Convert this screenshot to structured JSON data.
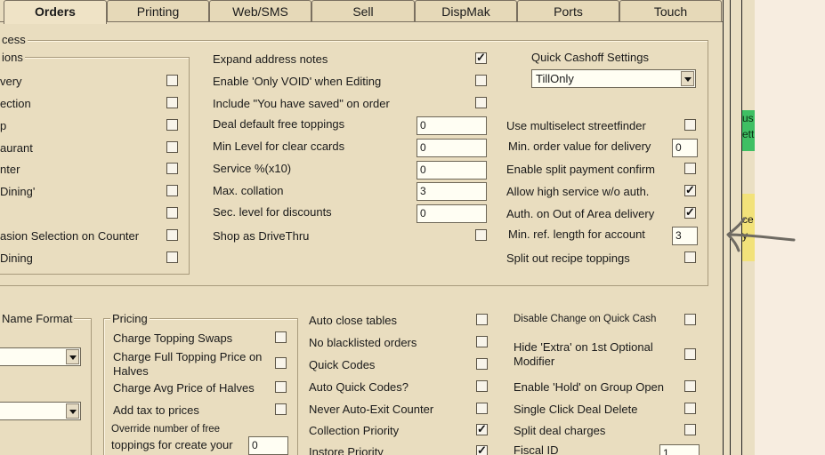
{
  "tabs": [
    "Orders",
    "Printing",
    "Web/SMS",
    "Sell",
    "DispMak",
    "Ports",
    "Touch"
  ],
  "top_group": {
    "legend": "cess",
    "inner_legend": "ions",
    "left_items": [
      {
        "label": "very",
        "checked": false
      },
      {
        "label": "ection",
        "checked": false
      },
      {
        "label": "p",
        "checked": false
      },
      {
        "label": "aurant",
        "checked": false
      },
      {
        "label": "nter",
        "checked": false
      },
      {
        "label": " Dining'",
        "checked": false
      },
      {
        "label": "",
        "checked": false
      },
      {
        "label": "asion Selection on Counter",
        "checked": false
      },
      {
        "label": "Dining",
        "checked": false
      }
    ],
    "mid_checks": [
      {
        "label": "Expand address notes",
        "checked": true
      },
      {
        "label": "Enable 'Only VOID' when Editing",
        "checked": false
      },
      {
        "label": "Include \"You have saved\" on order",
        "checked": false
      }
    ],
    "mid_fields": [
      {
        "label": "Deal default free toppings",
        "value": "0"
      },
      {
        "label": "Min Level for clear ccards",
        "value": "0"
      },
      {
        "label": "Service %(x10)",
        "value": "0"
      },
      {
        "label": "Max. collation",
        "value": "3"
      },
      {
        "label": "Sec. level for discounts",
        "value": "0"
      }
    ],
    "drive_thru": {
      "label": "Shop as DriveThru",
      "checked": false
    },
    "quick_cashoff": {
      "label": "Quick Cashoff Settings",
      "value": "TillOnly"
    },
    "right_items": [
      {
        "label": "Use multiselect streetfinder",
        "type": "check",
        "checked": false
      },
      {
        "label": "Min. order value for delivery",
        "type": "field",
        "value": "0"
      },
      {
        "label": "Enable split payment confirm",
        "type": "check",
        "checked": false
      },
      {
        "label": "Allow high service w/o auth.",
        "type": "check",
        "checked": true
      },
      {
        "label": "Auth. on Out of Area delivery",
        "type": "check",
        "checked": true
      },
      {
        "label": "Min. ref. length for account",
        "type": "field",
        "value": "3"
      },
      {
        "label": "Split out recipe toppings",
        "type": "check",
        "checked": false
      }
    ]
  },
  "bottom": {
    "name_format_legend": "Name Format",
    "pricing_legend": "Pricing",
    "pricing_items": [
      {
        "label": "Charge Topping Swaps",
        "checked": false
      },
      {
        "label": "Charge Full Topping Price on",
        "label2": "Halves",
        "checked": false
      },
      {
        "label": "Charge Avg Price of Halves",
        "checked": false
      },
      {
        "label": "Add tax to prices",
        "checked": false
      }
    ],
    "override": {
      "label": "Override number of free",
      "label2": "toppings for create your",
      "value": "0"
    },
    "mid_items": [
      {
        "label": "Auto close tables",
        "checked": false
      },
      {
        "label": "No blacklisted orders",
        "checked": false
      },
      {
        "label": "Quick Codes",
        "checked": false
      },
      {
        "label": "Auto Quick Codes?",
        "checked": false
      },
      {
        "label": "Never Auto-Exit Counter",
        "checked": false
      },
      {
        "label": "Collection Priority",
        "checked": true
      },
      {
        "label": "Instore Priority",
        "checked": true
      }
    ],
    "right_items": [
      {
        "label": "Disable Change on Quick Cash",
        "checked": false
      },
      {
        "label": "Hide 'Extra' on 1st Optional",
        "label2": "Modifier",
        "checked": false
      },
      {
        "label": "Enable 'Hold' on Group Open",
        "checked": false
      },
      {
        "label": "Single Click Deal Delete",
        "checked": false
      },
      {
        "label": "Split deal charges",
        "checked": false
      },
      {
        "label": "Fiscal ID",
        "value": "1"
      }
    ]
  },
  "side_chips": {
    "green": "us ett",
    "yellow": "ce y"
  }
}
